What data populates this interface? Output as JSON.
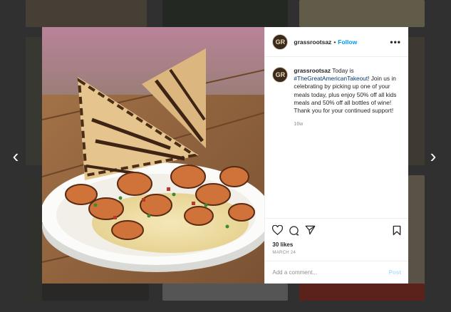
{
  "post": {
    "username": "grassrootsaz",
    "avatar_text": "GR",
    "follow_label": "Follow",
    "separator": "•",
    "more_label": "•••",
    "caption": {
      "username": "grassrootsaz",
      "text_before_tag": "Today is",
      "hashtag": "#TheGreatAmericanTakeout",
      "text_after_tag": "! Join us in celebrating by picking up one of your meals today, plus enjoy 50% off all kids meals and 50% off all bottles of wine! Thank you for your continued support!"
    },
    "age": "16w",
    "likes": "30 likes",
    "date": "MARCH 24",
    "comment_placeholder": "Add a comment...",
    "post_label": "Post"
  },
  "nav": {
    "prev": "‹",
    "next": "›"
  },
  "colors": {
    "link": "#0095f6",
    "hashtag": "#00376b",
    "muted": "#8e8e8e",
    "post_disabled": "#b2dffc"
  },
  "icons": [
    "heart-icon",
    "comment-icon",
    "share-icon",
    "bookmark-icon",
    "more-icon",
    "chevron-left-icon",
    "chevron-right-icon"
  ]
}
